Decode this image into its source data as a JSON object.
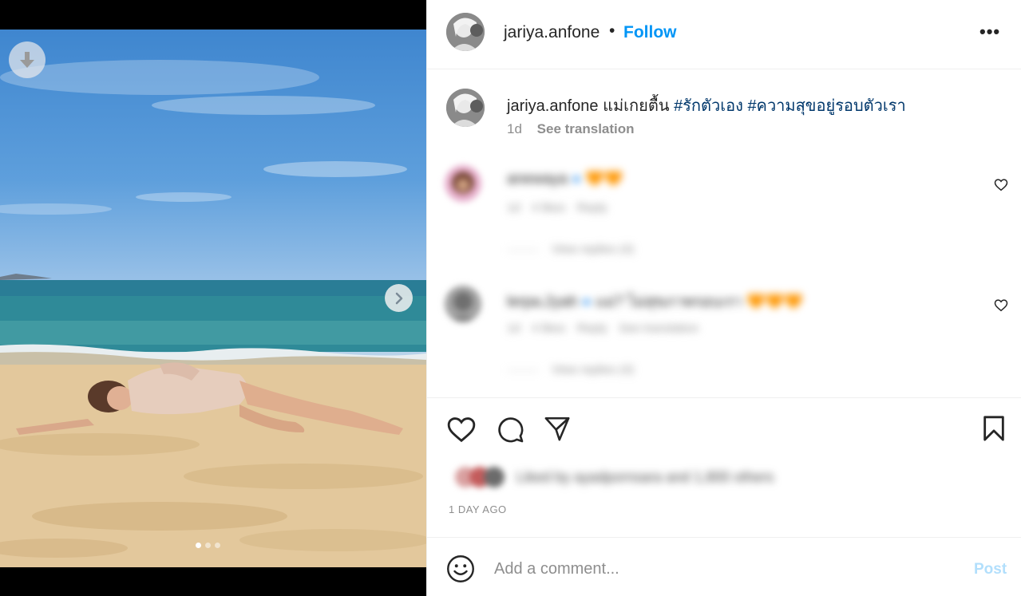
{
  "post": {
    "username": "jariya.anfone",
    "separator": "•",
    "follow_label": "Follow",
    "more_icon": "more-horizontal-icon"
  },
  "caption": {
    "username": "jariya.anfone",
    "text": "แม่เกยตื้น",
    "hashtags": [
      "#รักตัวเอง",
      "#ความสุขอยู่รอบตัวเรา"
    ],
    "age": "1d",
    "translate_label": "See translation"
  },
  "comments": [
    {
      "username": "anewaya",
      "verified": true,
      "text": "🧡🧡",
      "age": "1d",
      "likes": "4 likes",
      "reply_label": "Reply",
      "translate_label": "",
      "view_replies": "View replies (4)"
    },
    {
      "username": "lerpa.2yah",
      "verified": true,
      "text": "แม่? ไม่สุขภาพรอบเรา 🧡🧡🧡",
      "age": "1d",
      "likes": "4 likes",
      "reply_label": "Reply",
      "translate_label": "See translation",
      "view_replies": "View replies (4)"
    }
  ],
  "likes_text": "Liked by ayadpornsara and 1,800 others",
  "date": "1 DAY AGO",
  "comment_box": {
    "placeholder": "Add a comment...",
    "post_label": "Post"
  },
  "carousel": {
    "total": 3,
    "active": 0
  },
  "colors": {
    "follow": "#0095f6",
    "hashtag": "#00376b",
    "post_disabled": "#b2dffc",
    "muted": "#8e8e8e"
  }
}
